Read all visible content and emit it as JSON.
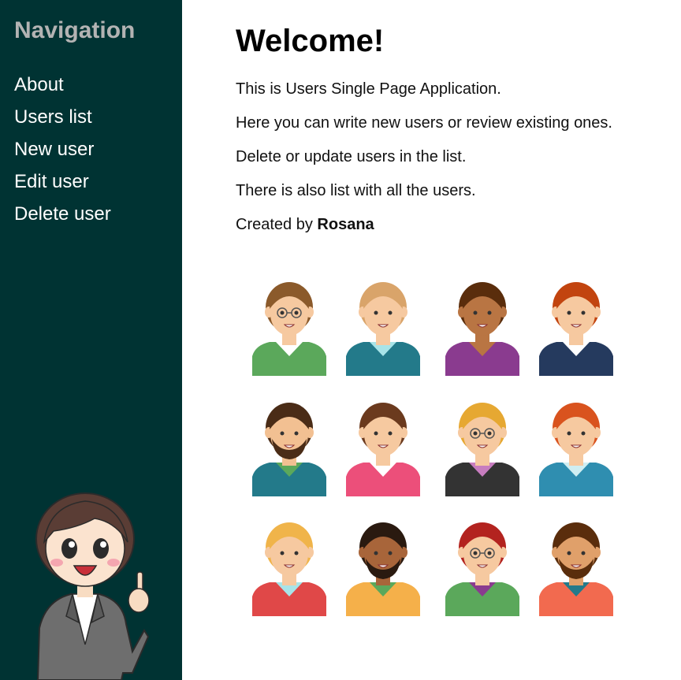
{
  "sidebar": {
    "title": "Navigation",
    "items": [
      {
        "label": "About"
      },
      {
        "label": "Users list"
      },
      {
        "label": "New user"
      },
      {
        "label": "Edit user"
      },
      {
        "label": "Delete user"
      }
    ]
  },
  "main": {
    "heading": "Welcome!",
    "paragraphs": [
      "This is Users Single Page Application.",
      "Here you can write new users or review existing ones.",
      "Delete or update users in the list.",
      "There is also list with all the users."
    ],
    "credit_prefix": "Created by",
    "credit_name": "Rosana"
  },
  "colors": {
    "sidebar_bg": "#003333",
    "nav_title": "#b3b3b3",
    "nav_link": "#ffffff"
  },
  "avatars": [
    {
      "hair": "#8b5a2b",
      "skin": "#f6c9a0",
      "shirt": "#5ba85b",
      "collar": "#ffffff",
      "glasses": true,
      "beard": false
    },
    {
      "hair": "#d9a46a",
      "skin": "#f6c9a0",
      "shirt": "#237a8a",
      "collar": "#a8e4e8",
      "glasses": false,
      "beard": false
    },
    {
      "hair": "#5a2d0c",
      "skin": "#b97543",
      "shirt": "#8a3b8f",
      "collar": "#b97543",
      "glasses": false,
      "beard": false
    },
    {
      "hair": "#c2440f",
      "skin": "#f6c9a0",
      "shirt": "#253a5e",
      "collar": "#ffffff",
      "glasses": false,
      "beard": false
    },
    {
      "hair": "#4a2c17",
      "skin": "#f2c092",
      "shirt": "#237a8a",
      "collar": "#5ba85b",
      "glasses": false,
      "beard": true
    },
    {
      "hair": "#6b3a1e",
      "skin": "#f6c9a0",
      "shirt": "#ec4f7a",
      "collar": "#ffffff",
      "glasses": false,
      "beard": false
    },
    {
      "hair": "#e6a832",
      "skin": "#f6c9a0",
      "shirt": "#333333",
      "collar": "#c77dbf",
      "glasses": true,
      "beard": false
    },
    {
      "hair": "#d9531e",
      "skin": "#f6c9a0",
      "shirt": "#2f8eb0",
      "collar": "#cfeef2",
      "glasses": false,
      "beard": false
    },
    {
      "hair": "#f0b44a",
      "skin": "#f6c9a0",
      "shirt": "#e04848",
      "collar": "#a8e4e8",
      "glasses": false,
      "beard": false
    },
    {
      "hair": "#2a1a10",
      "skin": "#a8653a",
      "shirt": "#f5b04a",
      "collar": "#5ba85b",
      "glasses": false,
      "beard": true
    },
    {
      "hair": "#b3231f",
      "skin": "#f6c9a0",
      "shirt": "#5ba85b",
      "collar": "#8a3b8f",
      "glasses": true,
      "beard": false
    },
    {
      "hair": "#5a2d0c",
      "skin": "#e0a06a",
      "shirt": "#f26a4f",
      "collar": "#237a8a",
      "glasses": false,
      "beard": true
    }
  ]
}
